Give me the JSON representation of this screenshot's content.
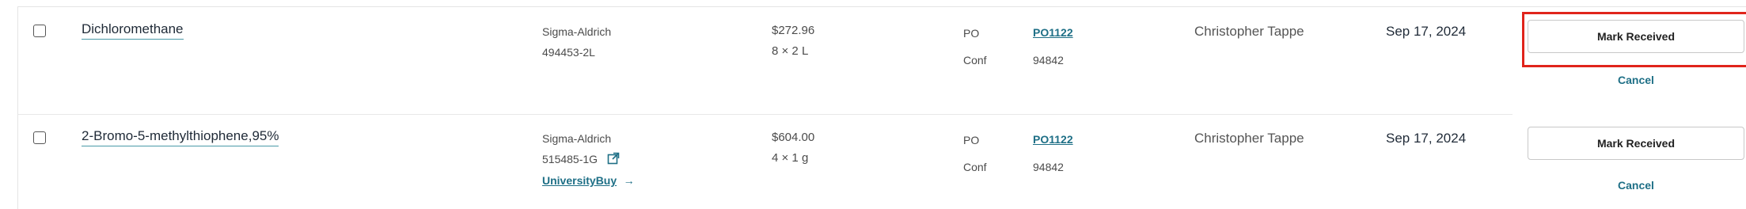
{
  "rows": [
    {
      "name": "Dichloromethane",
      "vendor": "Sigma-Aldrich",
      "catalog": "494453-2L",
      "price": "$272.96",
      "quantity": "8 × 2 L",
      "po_label": "PO",
      "po_value": "PO1122",
      "conf_label": "Conf",
      "conf_value": "94842",
      "requester": "Christopher Tappe",
      "date": "Sep 17, 2024",
      "action_label": "Mark Received",
      "cancel_label": "Cancel"
    },
    {
      "name": "2-Bromo-5-methylthiophene,95%",
      "vendor": "Sigma-Aldrich",
      "catalog": "515485-1G",
      "link_label": "UniversityBuy",
      "link_arrow": "→",
      "price": "$604.00",
      "quantity": "4 × 1 g",
      "po_label": "PO",
      "po_value": "PO1122",
      "conf_label": "Conf",
      "conf_value": "94842",
      "requester": "Christopher Tappe",
      "date": "Sep 17, 2024",
      "action_label": "Mark Received",
      "cancel_label": "Cancel"
    }
  ],
  "colors": {
    "highlight": "#e0241b",
    "link": "#1e6f86"
  },
  "icons": {
    "external_link": "external-link-icon",
    "arrow": "arrow-right-icon"
  }
}
